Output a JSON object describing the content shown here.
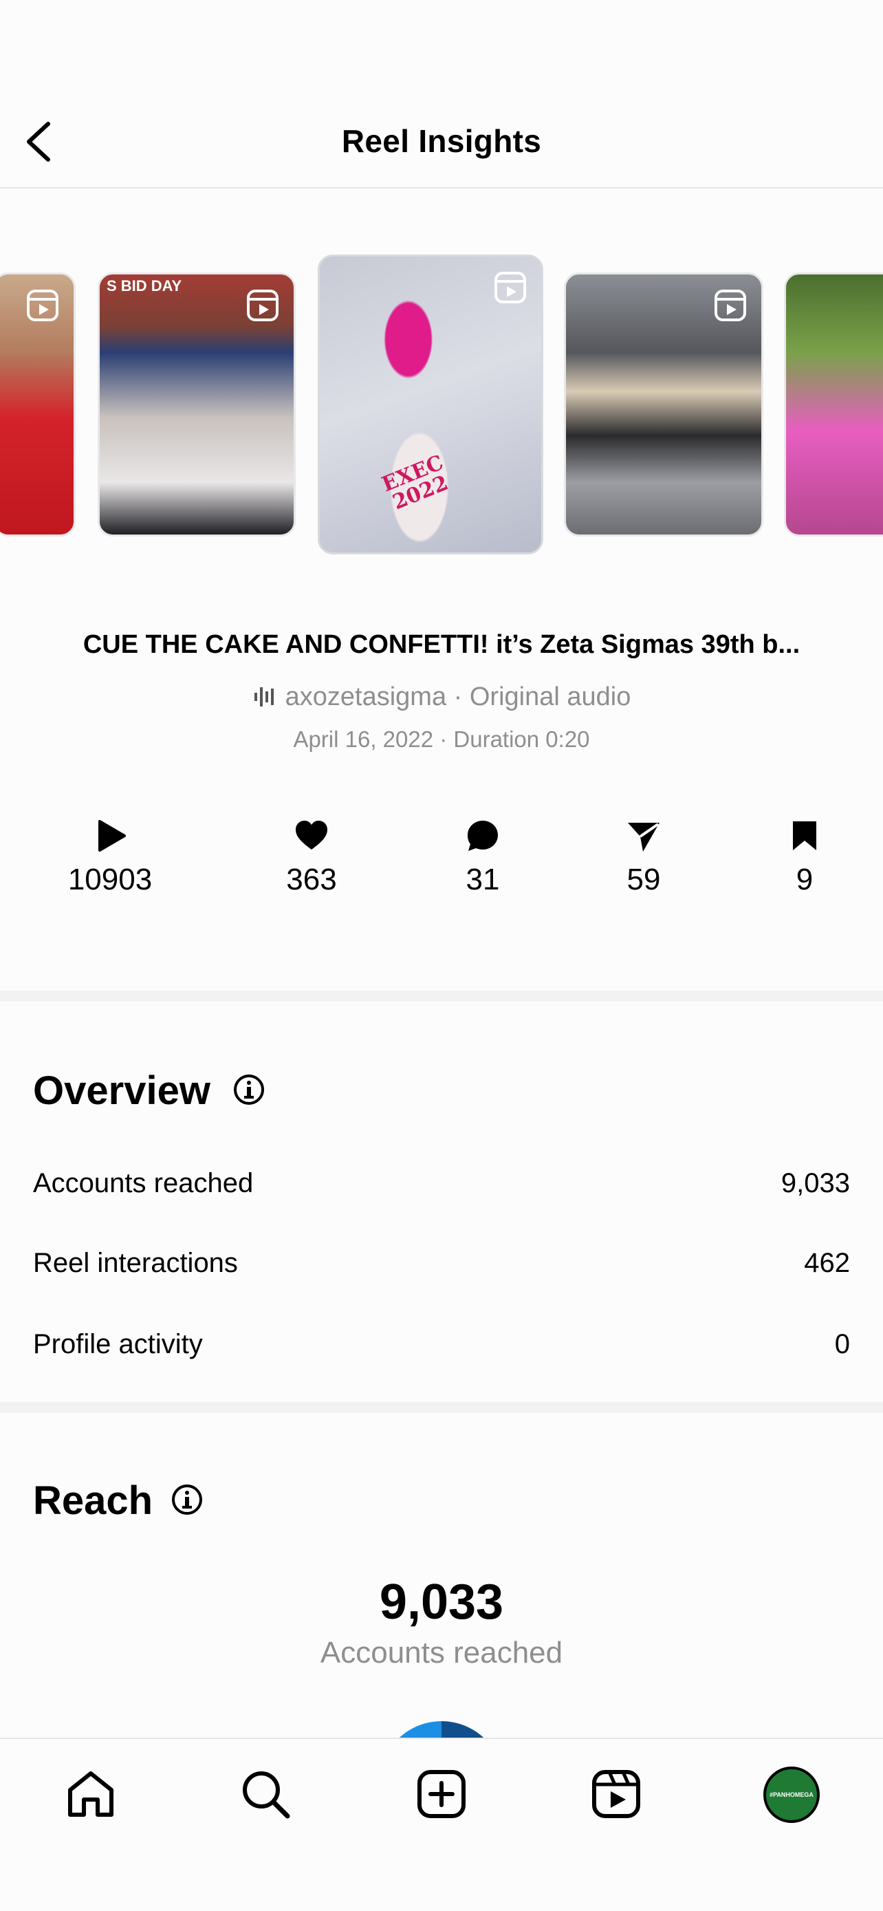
{
  "header": {
    "title": "Reel Insights",
    "back_icon": "chevron-left-icon"
  },
  "carousel": {
    "thumbs": [
      {
        "name": "reel-thumb-1",
        "icon": "reels-icon"
      },
      {
        "name": "reel-thumb-2",
        "icon": "reels-icon",
        "banner": "S BID DAY"
      },
      {
        "name": "reel-thumb-3-selected",
        "icon": "reels-icon",
        "cake_text": "EXEC 2022"
      },
      {
        "name": "reel-thumb-4",
        "icon": "reels-icon"
      },
      {
        "name": "reel-thumb-5",
        "icon": "reels-icon"
      }
    ]
  },
  "post": {
    "title": "CUE THE CAKE AND CONFETTI! it’s Zeta Sigmas 39th b...",
    "audio": "axozetasigma · Original audio",
    "meta": "April 16, 2022 · Duration 0:20"
  },
  "stats": {
    "plays": "10903",
    "likes": "363",
    "comments": "31",
    "shares": "59",
    "saves": "9"
  },
  "overview": {
    "title": "Overview",
    "rows": [
      {
        "label": "Accounts reached",
        "value": "9,033"
      },
      {
        "label": "Reel interactions",
        "value": "462"
      },
      {
        "label": "Profile activity",
        "value": "0"
      }
    ]
  },
  "reach": {
    "title": "Reach",
    "value": "9,033",
    "label": "Accounts reached"
  },
  "tabbar": {
    "items": [
      "home-icon",
      "search-icon",
      "create-icon",
      "reels-icon",
      "profile-avatar"
    ],
    "avatar_text": "#PANHOMEGA"
  },
  "colors": {
    "accent_blue": "#1a8fe3",
    "dark_blue": "#114f8c",
    "muted_text": "#8e8e8e"
  }
}
